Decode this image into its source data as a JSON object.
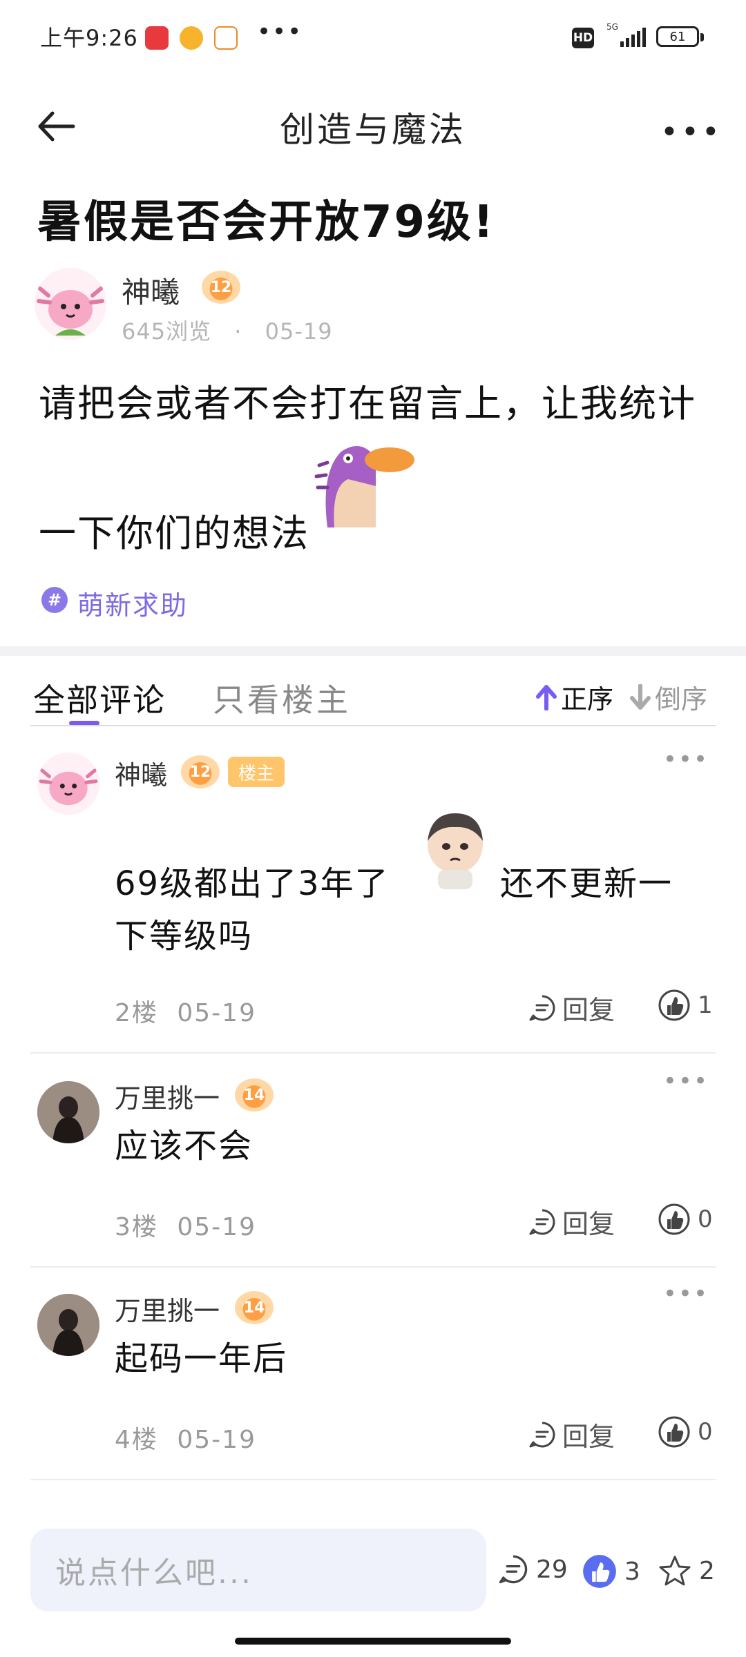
{
  "status_bar": {
    "time": "上午9:26",
    "dots": "•••",
    "hd": "HD",
    "network": "5G",
    "battery": "61"
  },
  "nav": {
    "title": "创造与魔法",
    "more": "•••"
  },
  "post": {
    "title": "暑假是否会开放79级!",
    "author": {
      "name": "神曦",
      "level": "12",
      "views": "645浏览",
      "date": "05-19"
    },
    "body_line1": "请把会或者不会打在留言上，让我统计",
    "body_line2": "一下你们的想法",
    "tag": "萌新求助"
  },
  "tabs": {
    "all": "全部评论",
    "host_only": "只看楼主",
    "sort_asc": "正序",
    "sort_desc": "倒序"
  },
  "comments": [
    {
      "name": "神曦",
      "level": "12",
      "badge": "楼主",
      "text_line1": "69级都出了3年了",
      "text_line1b": "还不更新一",
      "text_line2": "下等级吗",
      "floor": "2楼",
      "date": "05-19",
      "reply_label": "回复",
      "likes": "1"
    },
    {
      "name": "万里挑一",
      "level": "14",
      "text_line1": "应该不会",
      "floor": "3楼",
      "date": "05-19",
      "reply_label": "回复",
      "likes": "0"
    },
    {
      "name": "万里挑一",
      "level": "14",
      "text_line1": "起码一年后",
      "floor": "4楼",
      "date": "05-19",
      "reply_label": "回复",
      "likes": "0"
    }
  ],
  "bottom": {
    "placeholder": "说点什么吧...",
    "comments_count": "29",
    "likes_count": "3",
    "favorites_count": "2"
  },
  "colors": {
    "accent": "#7a5cf0",
    "tag": "#7d6be0",
    "level_badge": "#ff9f43",
    "host_badge": "#ffc56b"
  }
}
